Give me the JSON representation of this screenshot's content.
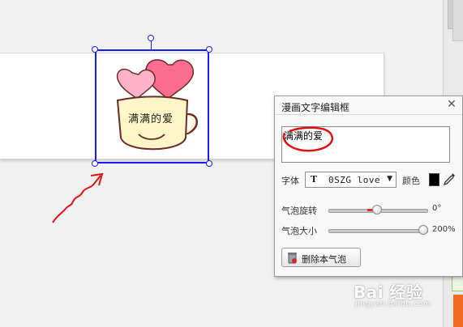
{
  "sticker": {
    "text": "满满的爱"
  },
  "dialog": {
    "title": "漫画文字编辑框",
    "text_value": "满满的爱",
    "font_label": "字体",
    "font_name": "0SZG love",
    "color_label": "颜色",
    "color_value": "#000000",
    "rotate_label": "气泡旋转",
    "rotate_value": "0°",
    "rotate_level_percent": 50,
    "size_label": "气泡大小",
    "size_value": "200%",
    "size_level_percent": 100,
    "delete_button": "删除本气泡"
  },
  "watermark": {
    "main": "Bai 经验",
    "sub": "jingyan.baidu.com"
  },
  "colors": {
    "selection": "#1a1aff",
    "annotation": "#e01010",
    "heart_pink": "#ff6d8e",
    "cup": "#fff6c8"
  }
}
